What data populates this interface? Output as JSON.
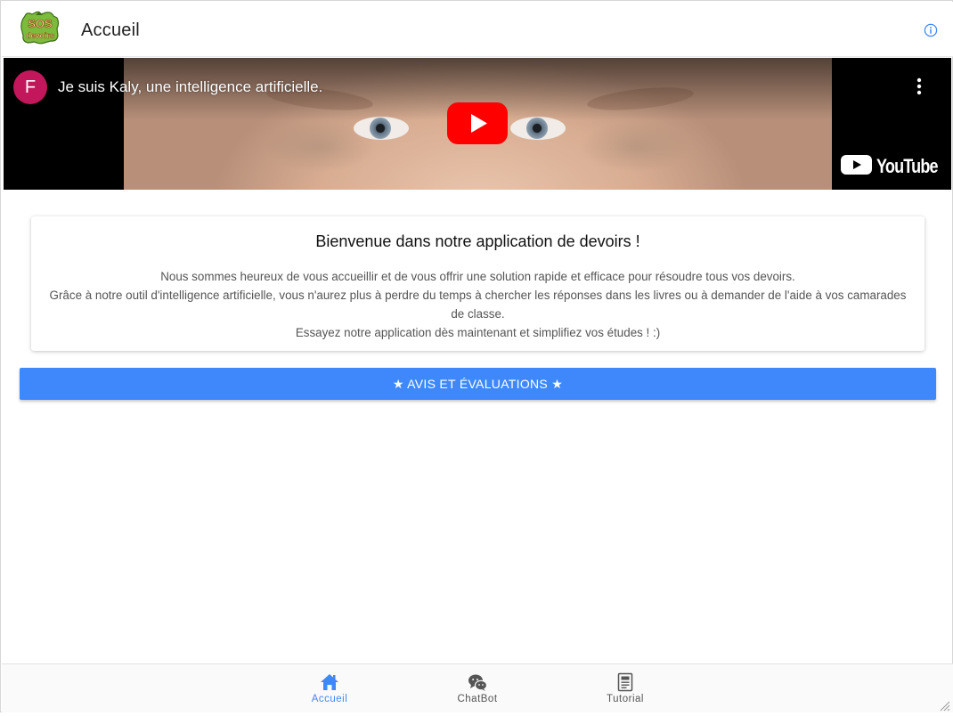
{
  "header": {
    "title": "Accueil",
    "logo_icon": "sos-devoirs-logo-icon",
    "info_icon": "info-icon"
  },
  "video": {
    "channel_initial": "F",
    "channel_color": "#c2185b",
    "title": "Je suis Kaly, une intelligence artificielle.",
    "provider_label": "YouTube",
    "play_icon": "play-icon",
    "more_icon": "more-vertical-icon"
  },
  "welcome": {
    "title": "Bienvenue dans notre application de devoirs !",
    "lines": [
      "Nous sommes heureux de vous accueillir et de vous offrir une solution rapide et efficace pour résoudre tous vos devoirs.",
      "Grâce à notre outil d'intelligence artificielle, vous n'aurez plus à perdre du temps à chercher les réponses dans les livres ou à demander de l'aide à vos camarades de classe.",
      "Essayez notre application dès maintenant et simplifiez vos études ! :)"
    ]
  },
  "reviews_button": {
    "label": "★ AVIS ET ÉVALUATIONS ★",
    "color": "#3f88fb"
  },
  "tabs": [
    {
      "label": "Accueil",
      "icon": "home-icon",
      "active": true
    },
    {
      "label": "ChatBot",
      "icon": "chat-bubbles-icon",
      "active": false
    },
    {
      "label": "Tutorial",
      "icon": "document-icon",
      "active": false
    }
  ],
  "colors": {
    "accent": "#3f88fb",
    "youtube_red": "#ff0000"
  }
}
